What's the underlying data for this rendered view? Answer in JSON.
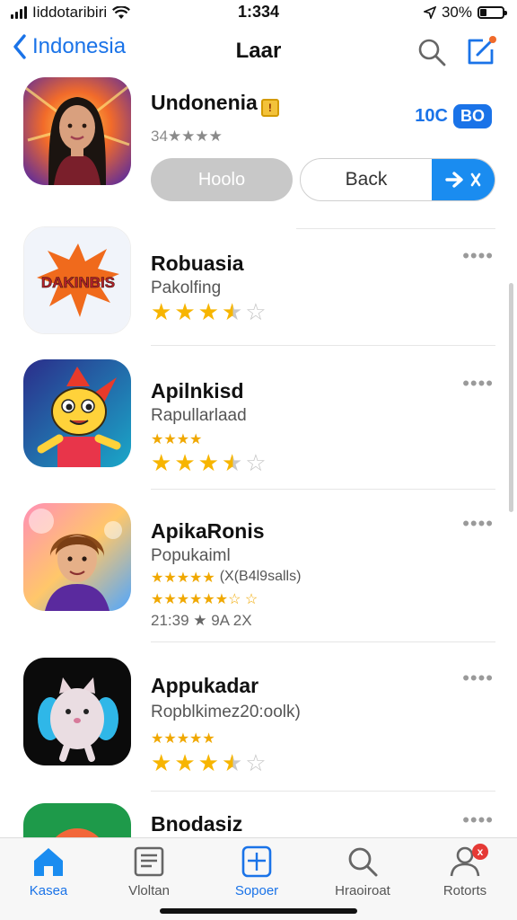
{
  "status_bar": {
    "carrier": "Iiddotaribiri",
    "time": "1:334",
    "battery": "30%",
    "battery_level": 0.3
  },
  "nav": {
    "back_label": "Indonesia",
    "title": "Laar"
  },
  "featured": {
    "name": "Undonenia",
    "rating_text": "34★★★★",
    "price_text": "10C",
    "price_pill": "BO",
    "open_button": "Hoolo",
    "back_button": "Back"
  },
  "apps": [
    {
      "name": "Robuasia",
      "subtitle": "Pakolfing",
      "logo_text": "DAKINBIS",
      "rating": 3.5
    },
    {
      "name": "Apilnkisd",
      "subtitle": "Rapullarlaad",
      "mini_stars": "★★★★",
      "rating": 3.5
    },
    {
      "name": "ApikaRonis",
      "subtitle": "Popukaiml",
      "mini_stars": "★★★★★",
      "mini_text": "(X(B4l9salls)",
      "second_mini": "★★★★★★☆ ☆",
      "meta": "21:39 ★ 9A 2X",
      "rating": 0
    },
    {
      "name": "Appukadar",
      "subtitle": "Ropblkimez20:oolk)",
      "mini_stars": "★★★★★",
      "rating": 3.5
    },
    {
      "name": "Bnodasiz",
      "subtitle": "",
      "rating": 0
    }
  ],
  "tabs": [
    {
      "label": "Kasea",
      "icon": "home-icon",
      "active": true
    },
    {
      "label": "Vloltan",
      "icon": "news-icon",
      "active": false
    },
    {
      "label": "Sopoer",
      "icon": "plus-square-icon",
      "active": false
    },
    {
      "label": "Hraoiroat",
      "icon": "search-icon",
      "active": false
    },
    {
      "label": "Rotorts",
      "icon": "person-icon",
      "active": false,
      "badge": "x"
    }
  ],
  "colors": {
    "accent": "#1a73e8",
    "star": "#f7b500",
    "badge": "#e53935"
  }
}
